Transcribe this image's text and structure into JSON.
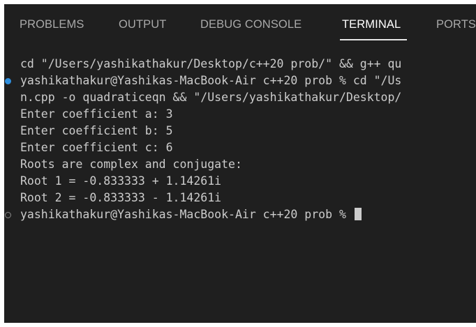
{
  "tabs": [
    {
      "label": "PROBLEMS",
      "active": false
    },
    {
      "label": "OUTPUT",
      "active": false
    },
    {
      "label": "DEBUG CONSOLE",
      "active": false
    },
    {
      "label": "TERMINAL",
      "active": true
    },
    {
      "label": "PORTS",
      "active": false
    }
  ],
  "terminal": {
    "lines": [
      "cd \"/Users/yashikathakur/Desktop/c++20 prob/\" && g++ qu",
      "yashikathakur@Yashikas-MacBook-Air c++20 prob % cd \"/Us",
      "n.cpp -o quadraticeqn && \"/Users/yashikathakur/Desktop/",
      "Enter coefficient a: 3",
      "Enter coefficient b: 5",
      "Enter coefficient c: 6",
      "Roots are complex and conjugate:",
      "Root 1 = -0.833333 + 1.14261i",
      "Root 2 = -0.833333 - 1.14261i",
      "yashikathakur@Yashikas-MacBook-Air c++20 prob % "
    ]
  },
  "colors": {
    "background": "#1f1f1f",
    "text": "#cccccc",
    "tab_inactive": "#a9a9a9",
    "tab_active": "#ffffff",
    "success_dot": "#2f8fde"
  },
  "icons": {
    "command_status_success": "filled-circle",
    "command_status_pending": "hollow-circle",
    "cursor": "block-cursor"
  }
}
